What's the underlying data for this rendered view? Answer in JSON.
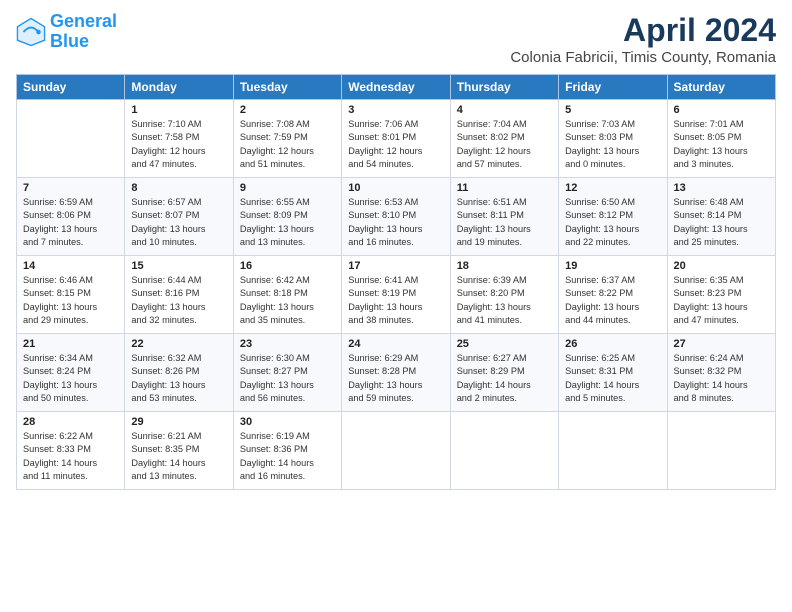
{
  "header": {
    "logo_line1": "General",
    "logo_line2": "Blue",
    "title": "April 2024",
    "subtitle": "Colonia Fabricii, Timis County, Romania"
  },
  "columns": [
    "Sunday",
    "Monday",
    "Tuesday",
    "Wednesday",
    "Thursday",
    "Friday",
    "Saturday"
  ],
  "weeks": [
    [
      {
        "day": "",
        "info": ""
      },
      {
        "day": "1",
        "info": "Sunrise: 7:10 AM\nSunset: 7:58 PM\nDaylight: 12 hours\nand 47 minutes."
      },
      {
        "day": "2",
        "info": "Sunrise: 7:08 AM\nSunset: 7:59 PM\nDaylight: 12 hours\nand 51 minutes."
      },
      {
        "day": "3",
        "info": "Sunrise: 7:06 AM\nSunset: 8:01 PM\nDaylight: 12 hours\nand 54 minutes."
      },
      {
        "day": "4",
        "info": "Sunrise: 7:04 AM\nSunset: 8:02 PM\nDaylight: 12 hours\nand 57 minutes."
      },
      {
        "day": "5",
        "info": "Sunrise: 7:03 AM\nSunset: 8:03 PM\nDaylight: 13 hours\nand 0 minutes."
      },
      {
        "day": "6",
        "info": "Sunrise: 7:01 AM\nSunset: 8:05 PM\nDaylight: 13 hours\nand 3 minutes."
      }
    ],
    [
      {
        "day": "7",
        "info": "Sunrise: 6:59 AM\nSunset: 8:06 PM\nDaylight: 13 hours\nand 7 minutes."
      },
      {
        "day": "8",
        "info": "Sunrise: 6:57 AM\nSunset: 8:07 PM\nDaylight: 13 hours\nand 10 minutes."
      },
      {
        "day": "9",
        "info": "Sunrise: 6:55 AM\nSunset: 8:09 PM\nDaylight: 13 hours\nand 13 minutes."
      },
      {
        "day": "10",
        "info": "Sunrise: 6:53 AM\nSunset: 8:10 PM\nDaylight: 13 hours\nand 16 minutes."
      },
      {
        "day": "11",
        "info": "Sunrise: 6:51 AM\nSunset: 8:11 PM\nDaylight: 13 hours\nand 19 minutes."
      },
      {
        "day": "12",
        "info": "Sunrise: 6:50 AM\nSunset: 8:12 PM\nDaylight: 13 hours\nand 22 minutes."
      },
      {
        "day": "13",
        "info": "Sunrise: 6:48 AM\nSunset: 8:14 PM\nDaylight: 13 hours\nand 25 minutes."
      }
    ],
    [
      {
        "day": "14",
        "info": "Sunrise: 6:46 AM\nSunset: 8:15 PM\nDaylight: 13 hours\nand 29 minutes."
      },
      {
        "day": "15",
        "info": "Sunrise: 6:44 AM\nSunset: 8:16 PM\nDaylight: 13 hours\nand 32 minutes."
      },
      {
        "day": "16",
        "info": "Sunrise: 6:42 AM\nSunset: 8:18 PM\nDaylight: 13 hours\nand 35 minutes."
      },
      {
        "day": "17",
        "info": "Sunrise: 6:41 AM\nSunset: 8:19 PM\nDaylight: 13 hours\nand 38 minutes."
      },
      {
        "day": "18",
        "info": "Sunrise: 6:39 AM\nSunset: 8:20 PM\nDaylight: 13 hours\nand 41 minutes."
      },
      {
        "day": "19",
        "info": "Sunrise: 6:37 AM\nSunset: 8:22 PM\nDaylight: 13 hours\nand 44 minutes."
      },
      {
        "day": "20",
        "info": "Sunrise: 6:35 AM\nSunset: 8:23 PM\nDaylight: 13 hours\nand 47 minutes."
      }
    ],
    [
      {
        "day": "21",
        "info": "Sunrise: 6:34 AM\nSunset: 8:24 PM\nDaylight: 13 hours\nand 50 minutes."
      },
      {
        "day": "22",
        "info": "Sunrise: 6:32 AM\nSunset: 8:26 PM\nDaylight: 13 hours\nand 53 minutes."
      },
      {
        "day": "23",
        "info": "Sunrise: 6:30 AM\nSunset: 8:27 PM\nDaylight: 13 hours\nand 56 minutes."
      },
      {
        "day": "24",
        "info": "Sunrise: 6:29 AM\nSunset: 8:28 PM\nDaylight: 13 hours\nand 59 minutes."
      },
      {
        "day": "25",
        "info": "Sunrise: 6:27 AM\nSunset: 8:29 PM\nDaylight: 14 hours\nand 2 minutes."
      },
      {
        "day": "26",
        "info": "Sunrise: 6:25 AM\nSunset: 8:31 PM\nDaylight: 14 hours\nand 5 minutes."
      },
      {
        "day": "27",
        "info": "Sunrise: 6:24 AM\nSunset: 8:32 PM\nDaylight: 14 hours\nand 8 minutes."
      }
    ],
    [
      {
        "day": "28",
        "info": "Sunrise: 6:22 AM\nSunset: 8:33 PM\nDaylight: 14 hours\nand 11 minutes."
      },
      {
        "day": "29",
        "info": "Sunrise: 6:21 AM\nSunset: 8:35 PM\nDaylight: 14 hours\nand 13 minutes."
      },
      {
        "day": "30",
        "info": "Sunrise: 6:19 AM\nSunset: 8:36 PM\nDaylight: 14 hours\nand 16 minutes."
      },
      {
        "day": "",
        "info": ""
      },
      {
        "day": "",
        "info": ""
      },
      {
        "day": "",
        "info": ""
      },
      {
        "day": "",
        "info": ""
      }
    ]
  ]
}
